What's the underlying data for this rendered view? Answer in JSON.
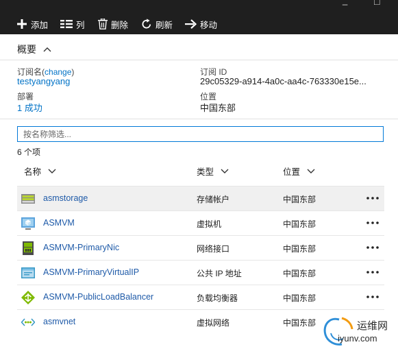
{
  "window_controls": {
    "minimize": "_",
    "maximize": "□"
  },
  "toolbar": {
    "add": "添加",
    "columns": "列",
    "delete": "删除",
    "refresh": "刷新",
    "move": "移动"
  },
  "summary": {
    "title": "概要",
    "subscription_label": "订阅名",
    "subscription_change": "change",
    "subscription_name": "testyangyang",
    "subscription_id_label": "订阅 ID",
    "subscription_id": "29c05329-a914-4a0c-aa4c-763330e15e...",
    "deployments_label": "部署",
    "deployments_value": "1 成功",
    "location_label": "位置",
    "location_value": "中国东部"
  },
  "filter": {
    "placeholder": "按名称筛选..."
  },
  "item_count": "6 个项",
  "columns": {
    "name": "名称",
    "type": "类型",
    "location": "位置"
  },
  "resources": [
    {
      "name": "asmstorage",
      "type": "存储帐户",
      "location": "中国东部",
      "icon": "storage-account-icon",
      "selected": true
    },
    {
      "name": "ASMVM",
      "type": "虚拟机",
      "location": "中国东部",
      "icon": "virtual-machine-icon",
      "selected": false
    },
    {
      "name": "ASMVM-PrimaryNic",
      "type": "网络接口",
      "location": "中国东部",
      "icon": "network-interface-icon",
      "selected": false
    },
    {
      "name": "ASMVM-PrimaryVirtualIP",
      "type": "公共 IP 地址",
      "location": "中国东部",
      "icon": "public-ip-icon",
      "selected": false
    },
    {
      "name": "ASMVM-PublicLoadBalancer",
      "type": "负载均衡器",
      "location": "中国东部",
      "icon": "load-balancer-icon",
      "selected": false
    },
    {
      "name": "asmvnet",
      "type": "虚拟网络",
      "location": "中国东部",
      "icon": "virtual-network-icon",
      "selected": false
    }
  ],
  "watermark": {
    "line1": "运维网",
    "line2": "iyunv.com"
  },
  "colors": {
    "toolbar_bg": "#1f1f1f",
    "link": "#0072c6",
    "filter_border": "#0078d7"
  }
}
